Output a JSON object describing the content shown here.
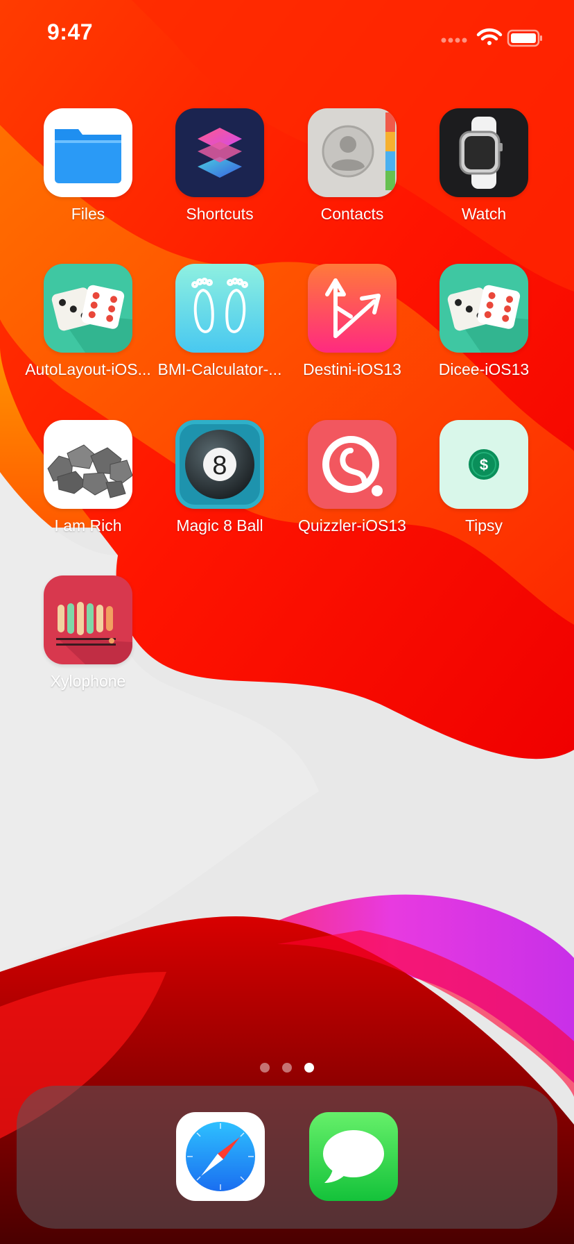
{
  "status_bar": {
    "time": "9:47",
    "signal_icon": "cellular-signal-icon",
    "wifi_icon": "wifi-icon",
    "battery_icon": "battery-icon"
  },
  "apps": [
    {
      "label": "Files",
      "icon": "files-folder-icon"
    },
    {
      "label": "Shortcuts",
      "icon": "shortcuts-icon"
    },
    {
      "label": "Contacts",
      "icon": "contacts-icon"
    },
    {
      "label": "Watch",
      "icon": "watch-icon"
    },
    {
      "label": "AutoLayout-iOS...",
      "icon": "dice-icon"
    },
    {
      "label": "BMI-Calculator-...",
      "icon": "footprints-icon"
    },
    {
      "label": "Destini-iOS13",
      "icon": "destini-arrows-icon"
    },
    {
      "label": "Dicee-iOS13",
      "icon": "dice-icon"
    },
    {
      "label": "I am Rich",
      "icon": "rocks-icon"
    },
    {
      "label": "Magic 8 Ball",
      "icon": "eight-ball-icon"
    },
    {
      "label": "Quizzler-iOS13",
      "icon": "quizzler-spiral-icon"
    },
    {
      "label": "Tipsy",
      "icon": "dollar-coin-icon"
    },
    {
      "label": "Xylophone",
      "icon": "xylophone-icon"
    }
  ],
  "page_indicator": {
    "pages": 3,
    "current_page": 3
  },
  "dock": [
    {
      "name": "Safari",
      "icon": "safari-compass-icon"
    },
    {
      "name": "Messages",
      "icon": "messages-bubble-icon"
    }
  ],
  "colors": {
    "wallpaper_red": "#ff1a00",
    "wallpaper_orange": "#ff6a00",
    "wallpaper_magenta": "#e53ad8",
    "wallpaper_gray": "#e9e9e9"
  }
}
